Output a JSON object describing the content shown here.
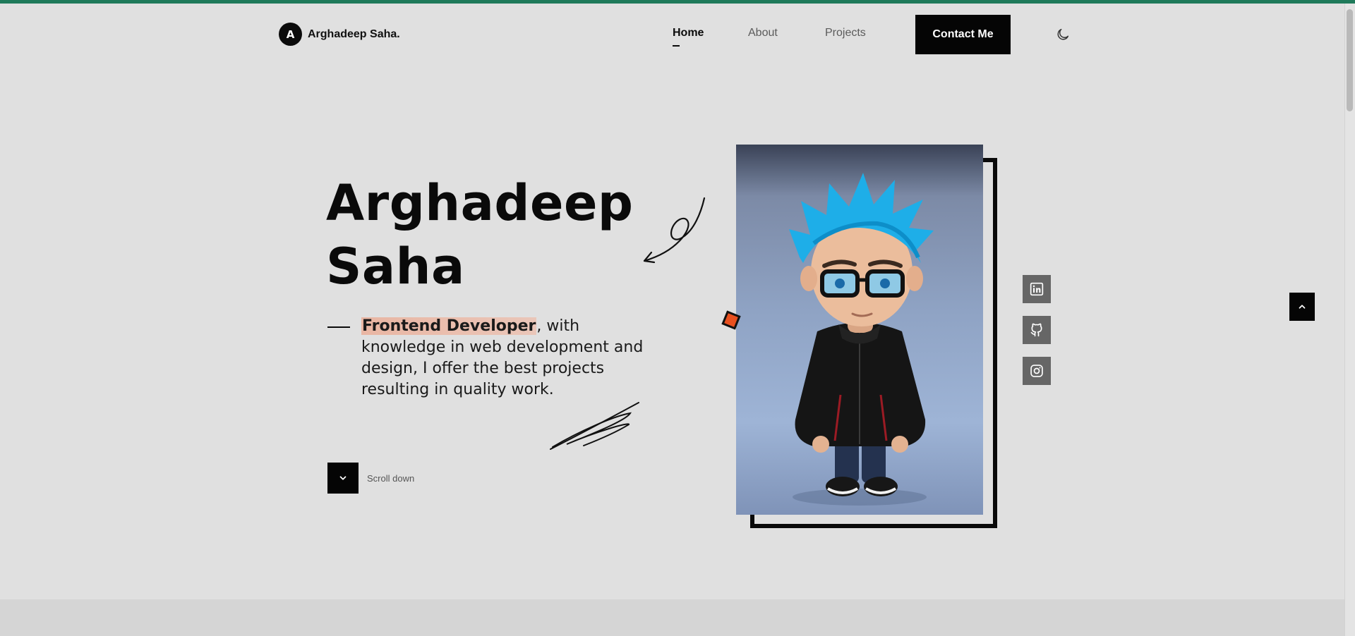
{
  "brand": {
    "initial": "A",
    "name": "Arghadeep Saha."
  },
  "nav": {
    "items": [
      {
        "label": "Home",
        "active": true
      },
      {
        "label": "About",
        "active": false
      },
      {
        "label": "Projects",
        "active": false
      }
    ],
    "contact_label": "Contact Me"
  },
  "hero": {
    "title_line1": "Arghadeep",
    "title_line2": "Saha",
    "role": "Frontend Developer",
    "description": ", with knowledge in web development and design, I offer the best projects resulting in quality work.",
    "scroll_label": "Scroll down"
  },
  "icons": {
    "theme": "moon-icon",
    "scroll": "chevron-down-icon",
    "to_top": "chevron-up-icon",
    "social": [
      "linkedin-icon",
      "github-icon",
      "instagram-icon"
    ]
  },
  "colors": {
    "accent_bar": "#1f7a5a",
    "background": "#e0e0e0",
    "highlight": "#e9b6a3",
    "diamond": "#e8501f",
    "social_bg": "#666666"
  }
}
